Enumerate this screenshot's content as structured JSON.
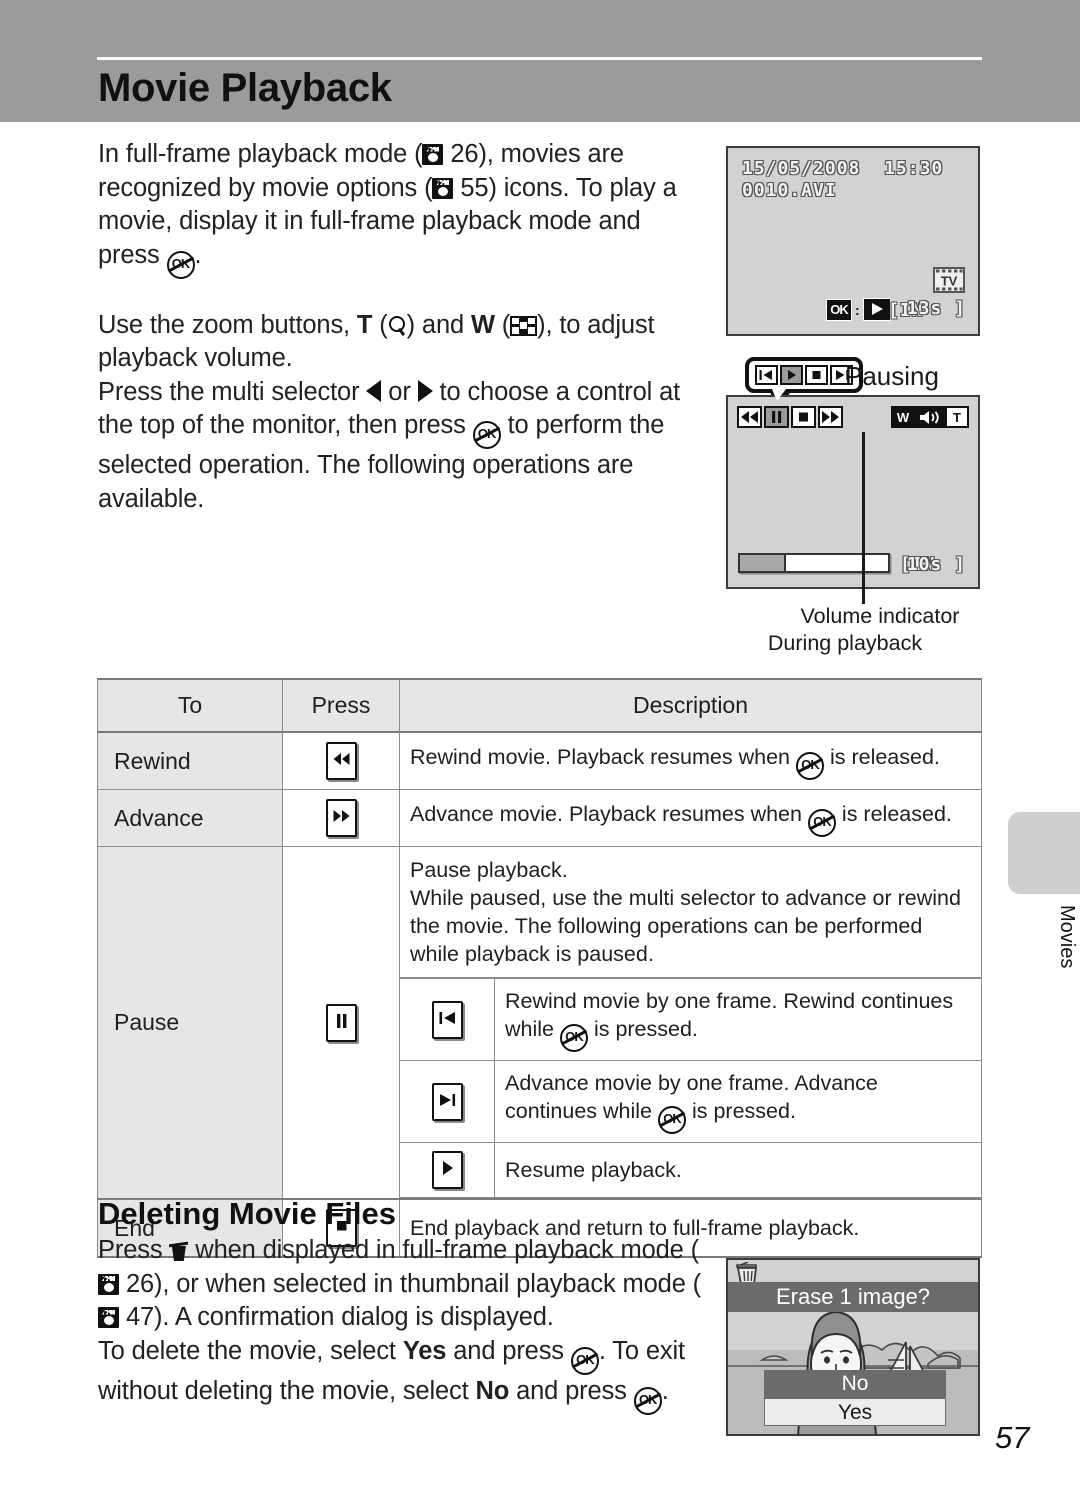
{
  "header": {
    "title": "Movie Playback"
  },
  "intro": {
    "p1_a": "In full-frame playback mode (",
    "p1_ref1": "26",
    "p1_b": "), movies are recognized by movie options (",
    "p1_ref2": "55",
    "p1_c": ") icons. To play a movie, display it in full-frame playback mode and press ",
    "p1_d": ".",
    "p2_a": "Use the zoom buttons, ",
    "p2_T": "T",
    "p2_b": " (",
    "p2_c": ") and ",
    "p2_W": "W",
    "p2_d": " (",
    "p2_e": "), to adjust playback volume.",
    "p3_a": "Press the multi selector ",
    "p3_or": " or ",
    "p3_b": " to choose a control at the top of the monitor, then press ",
    "p3_c": " to perform the selected operation. The following operations are available."
  },
  "monitor1": {
    "date": "15/05/2008",
    "time": "15:30",
    "filename": "0010.AVI",
    "ok_label": "OK",
    "colon": ":",
    "in_mark": "[IN",
    "duration": "13s ]",
    "movie_icon": "TV"
  },
  "monitor2": {
    "in_mark": "[IN",
    "duration": "10s ]",
    "vol_w": "W",
    "vol_t": "T",
    "progress_percent": 31
  },
  "callout": {
    "label": "Pausing",
    "buttons": [
      "rewind-frame",
      "play",
      "stop",
      "advance-frame"
    ],
    "selected_index": 1
  },
  "captions": {
    "volume_indicator": "Volume indicator",
    "during_playback": "During playback"
  },
  "table": {
    "headers": {
      "to": "To",
      "press": "Press",
      "description": "Description"
    },
    "rows": [
      {
        "to": "Rewind",
        "press_icon": "rewind-icon",
        "desc_a": "Rewind movie. Playback resumes when ",
        "desc_b": " is released."
      },
      {
        "to": "Advance",
        "press_icon": "advance-icon",
        "desc_a": "Advance movie. Playback resumes when ",
        "desc_b": " is released."
      },
      {
        "to": "Pause",
        "press_icon": "pause-icon",
        "desc_intro_1": "Pause playback.",
        "desc_intro_2": "While paused, use the multi selector to advance or rewind the movie. The following operations can be performed while playback is paused.",
        "sub_rows": [
          {
            "icon": "rewind-one-frame-icon",
            "text_a": "Rewind movie by one frame. Rewind continues while ",
            "text_b": " is pressed."
          },
          {
            "icon": "advance-one-frame-icon",
            "text_a": "Advance movie by one frame. Advance continues while ",
            "text_b": " is pressed."
          },
          {
            "icon": "play-icon",
            "text_a": "Resume playback.",
            "text_b": ""
          }
        ]
      },
      {
        "to": "End",
        "press_icon": "stop-icon",
        "desc_a": "End playback and return to full-frame playback.",
        "desc_b": ""
      }
    ]
  },
  "section2": {
    "title": "Deleting Movie Files",
    "p1_a": "Press ",
    "p1_b": " when displayed in full-frame playback mode (",
    "p1_ref1": "26",
    "p1_c": "), or when selected in thumbnail playback mode (",
    "p1_ref2": "47",
    "p1_d": "). A confirmation dialog is displayed.",
    "p2_a": "To delete the movie, select ",
    "p2_yes": "Yes",
    "p2_b": " and press ",
    "p2_c": ". To exit without deleting the movie, select ",
    "p2_no": "No",
    "p2_d": " and press ",
    "p2_e": "."
  },
  "erase_dialog": {
    "title": "Erase 1 image?",
    "option_no": "No",
    "option_yes": "Yes",
    "selected": "Yes"
  },
  "side_tab": {
    "label": "Movies"
  },
  "footer": {
    "page_number": "57"
  },
  "colors": {
    "header_band": "#9b9b9b",
    "table_head": "#e6e6e6",
    "monitor_bg": "#d2d2d2",
    "tab_gray": "#cfcfcf"
  }
}
